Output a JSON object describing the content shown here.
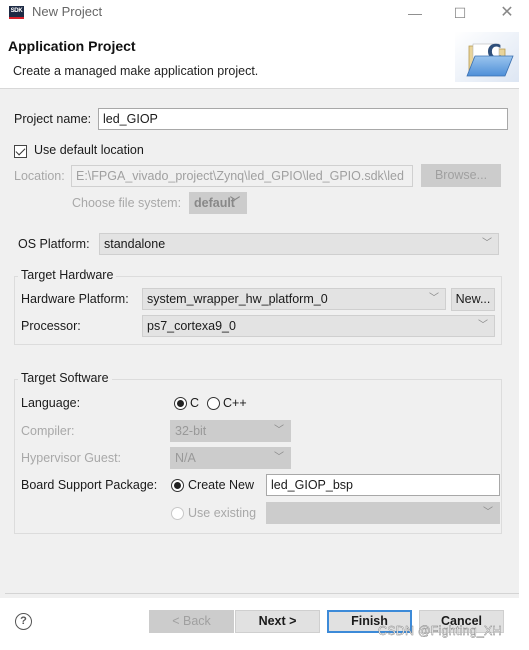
{
  "window": {
    "app_icon_text": "SDK",
    "title": "New Project",
    "controls": {
      "minimize": "—",
      "maximize": "☐",
      "close": "✕"
    }
  },
  "header": {
    "title": "Application Project",
    "description": "Create a managed make application project.",
    "icon": "new-c-project-folder-icon"
  },
  "project": {
    "name_label": "Project name:",
    "name_value": "led_GIOP",
    "use_default_location_label": "Use default location",
    "use_default_location_checked": true,
    "location_label": "Location:",
    "location_value": "E:\\FPGA_vivado_project\\Zynq\\led_GPIO\\led_GPIO.sdk\\led",
    "browse_label": "Browse...",
    "file_system_label": "Choose file system:",
    "file_system_value": "default"
  },
  "os_platform": {
    "label": "OS Platform:",
    "value": "standalone"
  },
  "target_hardware": {
    "title": "Target Hardware",
    "hardware_platform_label": "Hardware Platform:",
    "hardware_platform_value": "system_wrapper_hw_platform_0",
    "new_label": "New...",
    "processor_label": "Processor:",
    "processor_value": "ps7_cortexa9_0"
  },
  "target_software": {
    "title": "Target Software",
    "language_label": "Language:",
    "language_options": [
      "C",
      "C++"
    ],
    "language_selected": "C",
    "compiler_label": "Compiler:",
    "compiler_value": "32-bit",
    "hypervisor_label": "Hypervisor Guest:",
    "hypervisor_value": "N/A",
    "bsp_label": "Board Support Package:",
    "bsp_create_new_label": "Create New",
    "bsp_create_new_value": "led_GIOP_bsp",
    "bsp_use_existing_label": "Use existing",
    "bsp_use_existing_value": "",
    "bsp_selected": "Create New"
  },
  "footer": {
    "help": "?",
    "back": "< Back",
    "next": "Next >",
    "finish": "Finish",
    "cancel": "Cancel"
  },
  "watermark": "CSDN @Fighting_XH",
  "colors": {
    "accent": "#3c8ad8",
    "dialog_bg": "#f0f0f0",
    "disabled": "#cccccc"
  }
}
